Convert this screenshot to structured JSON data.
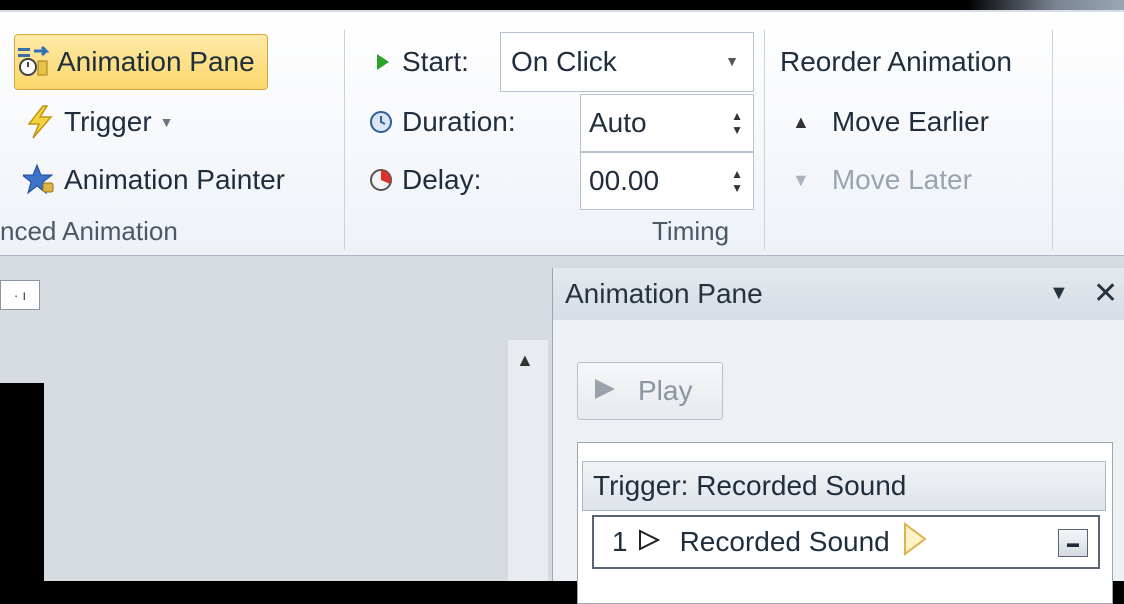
{
  "ribbon": {
    "advanced_animation": {
      "animation_pane": "Animation Pane",
      "trigger": "Trigger",
      "animation_painter": "Animation Painter",
      "label": "nced Animation"
    },
    "timing": {
      "start_label": "Start:",
      "start_value": "On Click",
      "duration_label": "Duration:",
      "duration_value": "Auto",
      "delay_label": "Delay:",
      "delay_value": "00.00",
      "label": "Timing"
    },
    "reorder": {
      "title": "Reorder Animation",
      "move_earlier": "Move Earlier",
      "move_later": "Move Later"
    }
  },
  "workarea": {
    "ruler_marker": "· ı"
  },
  "pane": {
    "title": "Animation Pane",
    "play": "Play",
    "trigger_header": "Trigger: Recorded Sound",
    "item_number": "1",
    "item_name": "Recorded Sound"
  },
  "colors": {
    "active_button": "#fbd86b",
    "play_icon_green": "#2aa52a"
  }
}
